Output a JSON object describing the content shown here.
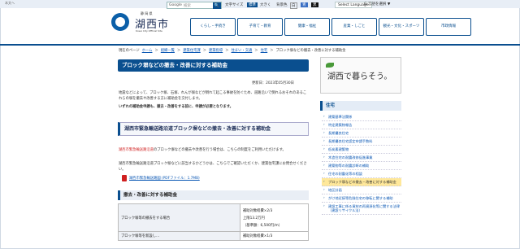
{
  "header": {
    "corner_link": "本文へ",
    "search_brand": "Google",
    "search_placeholder": "検索",
    "search_button": "🔍",
    "tools": [
      "文字サイズ",
      "標準",
      "大きく",
      "背景色",
      "白",
      "青",
      "黒"
    ],
    "lang_label": "Select Language",
    "lang_select": "G 言語を選択 ▼",
    "logo_small": "静 岡 県",
    "logo_main": "湖西市",
    "logo_en": "Kosai City Official Site"
  },
  "nav": [
    "くらし・手続き",
    "子育て・教育",
    "健康・福祉",
    "産業・しごと",
    "観光・文化・スポーツ",
    "市政情報"
  ],
  "breadcrumb": [
    "現在のページ",
    "ホーム",
    "組織一覧",
    "建築住宅課",
    "建築指導",
    "住まい・交通",
    "住宅",
    "ブロック塀などの撤去・改善に対する補助金"
  ],
  "page": {
    "title": "ブロック塀などの撤去・改善に対する補助金",
    "updated": "更新日：2023年05月30日",
    "intro": "地震などによって、ブロック塀、石塀、れんが塀などが倒れて起こる事故を防ぐため、道路沿いで倒れるおそれのあるこれらの塀を撤去や改善する方に補助金を交付します。",
    "note": "いずれの補助金申請も、撤去・改善をする前に、申請が必要となります。",
    "section_title": "湖西市緊急輸送路沿道ブロック塀などの撤去・改善に対する補助金",
    "section_p1_red": "湖西市緊急輸送路沿道",
    "section_p1_rest": "のブロック塀などの撤去や改善を行う場合は、こちらの制度をご利用いただけます。",
    "section_p2": "湖西市緊急輸送路沿道ブロック塀などに該当するかどうかは、こちらでご確認いただくか、建築住宅課にお問合せください。",
    "pdf_link": "湖西市緊急輸送路図 (PDFファイル：1.7MB)",
    "subsection_title": "撤去・改善に対する補助金",
    "table": [
      {
        "label": "ブロック塀等の撤去をする場合",
        "value1": "補助対象経費×2/3",
        "value2": "上限13.2万円",
        "value3": "（基準額：6,500円/m）"
      },
      {
        "label": "ブロック塀等を新設し…",
        "value1": "補助対象経費×1/3",
        "value2": "",
        "value3": ""
      }
    ]
  },
  "sidebar": {
    "banner_text": "湖西で暮らそう。",
    "title": "住宅",
    "items": [
      {
        "label": "建築基準法関係",
        "active": false
      },
      {
        "label": "特定建築物報告",
        "active": false
      },
      {
        "label": "長期優良住宅",
        "active": false
      },
      {
        "label": "長期優良住宅認定申請手数料",
        "active": false
      },
      {
        "label": "低炭素建築物",
        "active": false
      },
      {
        "label": "木造住宅の耐震改修促進事業",
        "active": false
      },
      {
        "label": "建築物等の耐震診断の補助",
        "active": false
      },
      {
        "label": "住宅の耐震化等の相談",
        "active": false
      },
      {
        "label": "ブロック塀などの撤去・改善に対する補助金",
        "active": true
      },
      {
        "label": "地区計画",
        "active": false
      },
      {
        "label": "がけ地近接等危険住宅の移転に関する補助",
        "active": false
      },
      {
        "label": "建設工事に係る資材の再資源化等に関する法律（建設リサイクル法）",
        "active": false
      }
    ]
  }
}
